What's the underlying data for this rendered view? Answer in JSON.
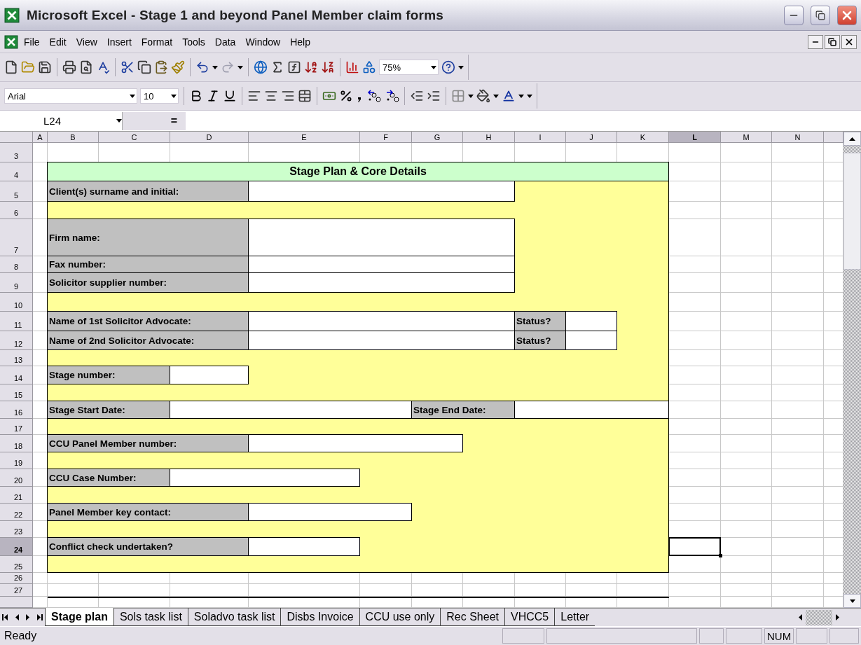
{
  "window": {
    "title": "Microsoft Excel - Stage 1 and beyond Panel Member claim forms"
  },
  "menu": [
    {
      "label": "File"
    },
    {
      "label": "Edit"
    },
    {
      "label": "View"
    },
    {
      "label": "Insert"
    },
    {
      "label": "Format"
    },
    {
      "label": "Tools"
    },
    {
      "label": "Data"
    },
    {
      "label": "Window"
    },
    {
      "label": "Help"
    }
  ],
  "toolbar": {
    "zoom": "75%",
    "font": "Arial",
    "font_size": "10"
  },
  "formula_bar": {
    "name_box": "L24",
    "equals": "="
  },
  "columns": [
    {
      "letter": "A",
      "selected": false
    },
    {
      "letter": "B",
      "selected": false
    },
    {
      "letter": "C",
      "selected": false
    },
    {
      "letter": "D",
      "selected": false
    },
    {
      "letter": "E",
      "selected": false
    },
    {
      "letter": "F",
      "selected": false
    },
    {
      "letter": "G",
      "selected": false
    },
    {
      "letter": "H",
      "selected": false
    },
    {
      "letter": "I",
      "selected": false
    },
    {
      "letter": "J",
      "selected": false
    },
    {
      "letter": "K",
      "selected": false
    },
    {
      "letter": "L",
      "selected": true
    },
    {
      "letter": "M",
      "selected": false
    },
    {
      "letter": "N",
      "selected": false
    }
  ],
  "rows": [
    {
      "number": "3",
      "selected": false
    },
    {
      "number": "4",
      "selected": false
    },
    {
      "number": "5",
      "selected": false
    },
    {
      "number": "6",
      "selected": false
    },
    {
      "number": "7",
      "selected": false
    },
    {
      "number": "8",
      "selected": false
    },
    {
      "number": "9",
      "selected": false
    },
    {
      "number": "10",
      "selected": false
    },
    {
      "number": "11",
      "selected": false
    },
    {
      "number": "12",
      "selected": false
    },
    {
      "number": "13",
      "selected": false
    },
    {
      "number": "14",
      "selected": false
    },
    {
      "number": "15",
      "selected": false
    },
    {
      "number": "16",
      "selected": false
    },
    {
      "number": "17",
      "selected": false
    },
    {
      "number": "18",
      "selected": false
    },
    {
      "number": "19",
      "selected": false
    },
    {
      "number": "20",
      "selected": false
    },
    {
      "number": "21",
      "selected": false
    },
    {
      "number": "22",
      "selected": false
    },
    {
      "number": "23",
      "selected": false
    },
    {
      "number": "24",
      "selected": true
    },
    {
      "number": "25",
      "selected": false
    },
    {
      "number": "26",
      "selected": false
    },
    {
      "number": "27",
      "selected": false
    }
  ],
  "form": {
    "title": "Stage Plan & Core Details",
    "fields": [
      {
        "label": "Client(s) surname and initial:"
      },
      {
        "label": "Firm name:"
      },
      {
        "label": "Fax number:"
      },
      {
        "label": "Solicitor supplier number:"
      },
      {
        "label": "Name of 1st Solicitor Advocate:"
      },
      {
        "label": "Status?"
      },
      {
        "label": "Name of 2nd Solicitor Advocate:"
      },
      {
        "label": "Status?"
      },
      {
        "label": "Stage number:"
      },
      {
        "label": "Stage Start Date:"
      },
      {
        "label": "Stage End Date:"
      },
      {
        "label": "CCU Panel Member number:"
      },
      {
        "label": "CCU Case Number:"
      },
      {
        "label": "Panel Member key contact:"
      },
      {
        "label": "Conflict check undertaken?"
      }
    ]
  },
  "sheet_tabs": [
    {
      "label": "Stage plan",
      "selected": true
    },
    {
      "label": "Sols task list",
      "selected": false
    },
    {
      "label": "Soladvo task list",
      "selected": false
    },
    {
      "label": "Disbs Invoice",
      "selected": false
    },
    {
      "label": "CCU use only",
      "selected": false
    },
    {
      "label": "Rec Sheet",
      "selected": false
    },
    {
      "label": "VHCC5",
      "selected": false
    },
    {
      "label": "Letter",
      "selected": false
    }
  ],
  "status_bar": {
    "text": "Ready",
    "indicator": "NUM"
  }
}
